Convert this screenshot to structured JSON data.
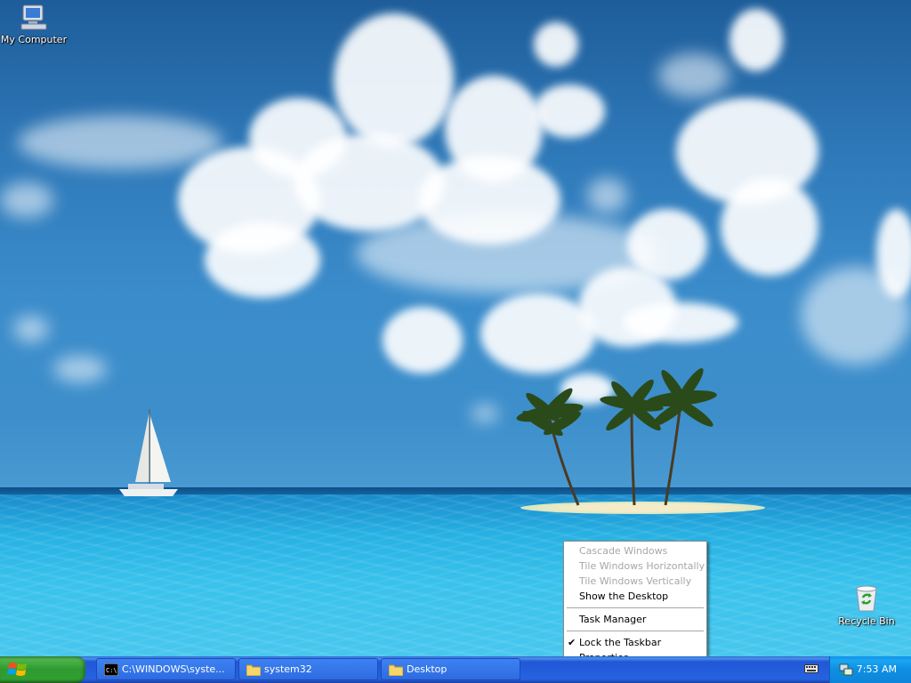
{
  "desktop": {
    "icons": [
      {
        "label": "My Computer"
      },
      {
        "label": "Recycle Bin"
      }
    ]
  },
  "context_menu": {
    "items": [
      {
        "label": "Cascade Windows",
        "enabled": false
      },
      {
        "label": "Tile Windows Horizontally",
        "enabled": false
      },
      {
        "label": "Tile Windows Vertically",
        "enabled": false
      },
      {
        "label": "Show the Desktop",
        "enabled": true
      },
      {
        "label": "Task Manager",
        "enabled": true
      },
      {
        "label": "Lock the Taskbar",
        "enabled": true,
        "checked": true
      },
      {
        "label": "Properties",
        "enabled": true
      }
    ]
  },
  "taskbar": {
    "start_icon": "windows-flag-icon",
    "tasks": [
      {
        "label": "C:\\WINDOWS\\syste...",
        "icon": "command-prompt-icon"
      },
      {
        "label": "system32",
        "icon": "folder-icon"
      },
      {
        "label": "Desktop",
        "icon": "folder-icon"
      }
    ],
    "tray": {
      "clock": "7:53 AM",
      "icons": [
        "keyboard-language-icon",
        "network-icon"
      ]
    }
  },
  "colors": {
    "taskbar_blue": "#2663e0",
    "start_green": "#2f9a2f",
    "tray_blue": "#0f8ee3",
    "menu_disabled": "#a7a6aa"
  }
}
